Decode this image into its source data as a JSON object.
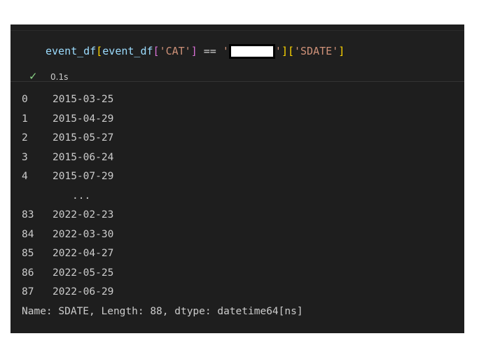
{
  "cell": {
    "code": {
      "var": "event_df",
      "lbracket": "[",
      "var2": "event_df",
      "lbracket2": "[",
      "key": "'CAT'",
      "rbracket2": "]",
      "op": " == ",
      "open_quote": "'",
      "close_quote": "'",
      "rbracket": "]",
      "lbracket3": "[",
      "key2": "'SDATE'",
      "rbracket3": "]"
    },
    "status": {
      "icon": "check-icon",
      "duration": "0.1s"
    }
  },
  "output": {
    "rows_head": [
      {
        "index": "0",
        "date": "2015-03-25"
      },
      {
        "index": "1",
        "date": "2015-04-29"
      },
      {
        "index": "2",
        "date": "2015-05-27"
      },
      {
        "index": "3",
        "date": "2015-06-24"
      },
      {
        "index": "4",
        "date": "2015-07-29"
      }
    ],
    "ellipsis": "...",
    "rows_tail": [
      {
        "index": "83",
        "date": "2022-02-23"
      },
      {
        "index": "84",
        "date": "2022-03-30"
      },
      {
        "index": "85",
        "date": "2022-04-27"
      },
      {
        "index": "86",
        "date": "2022-05-25"
      },
      {
        "index": "87",
        "date": "2022-06-29"
      }
    ],
    "footer": "Name: SDATE, Length: 88, dtype: datetime64[ns]"
  },
  "colors": {
    "background": "#1e1e1e",
    "identifier": "#9cdcfe",
    "string": "#ce9178",
    "bracket_gold": "#ffd700",
    "bracket_purple": "#da70d6",
    "success": "#89d185"
  }
}
